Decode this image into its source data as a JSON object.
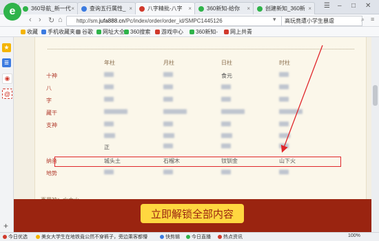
{
  "browser": {
    "tabs": [
      {
        "title": "360导航_新一代",
        "color": "#2fb34a",
        "active": false
      },
      {
        "title": "查询五行属性_",
        "color": "#3c7be0",
        "active": false
      },
      {
        "title": "八字精批-八字",
        "color": "#d0392b",
        "active": true
      },
      {
        "title": "360新知-给你",
        "color": "#2fb34a",
        "active": false
      },
      {
        "title": "创建新知_360新",
        "color": "#2fb34a",
        "active": false
      }
    ],
    "url_prefix": "http://sm.",
    "url_domain": "jufa888.cn",
    "url_rest": "/Pc/index/order/order_id/SMPC1445126",
    "search_value": "高玩竟遭小学生暴虐",
    "bookmarks": [
      {
        "label": "收藏",
        "color": "#f4b400"
      },
      {
        "label": "手机收藏夹",
        "color": "#3c7be0"
      },
      {
        "label": "谷歌",
        "color": "#888888"
      },
      {
        "label": "网址大全",
        "color": "#2fb34a"
      },
      {
        "label": "360搜索",
        "color": "#2fb34a"
      },
      {
        "label": "游戏中心",
        "color": "#d0392b"
      },
      {
        "label": "360新知-",
        "color": "#2fb34a"
      },
      {
        "label": "网上共青",
        "color": "#d0392b"
      }
    ]
  },
  "sidebar": {
    "icons": [
      "star-icon",
      "list-icon",
      "weibo-icon",
      "at-icon"
    ]
  },
  "bazi": {
    "columns": [
      "年柱",
      "月柱",
      "日柱",
      "时柱"
    ],
    "rows": [
      {
        "label": "十神",
        "v": [
          "",
          "",
          "食元",
          ""
        ]
      },
      {
        "label": "八",
        "v": [
          "",
          "",
          "",
          ""
        ]
      },
      {
        "label": "字",
        "v": [
          "",
          "",
          "",
          ""
        ]
      },
      {
        "label": "藏干",
        "v": [
          "",
          "",
          "",
          ""
        ]
      },
      {
        "label": "支神",
        "v": [
          "",
          "",
          "",
          ""
        ]
      },
      {
        "label": "",
        "v": [
          "正",
          "",
          "",
          ""
        ]
      },
      {
        "label": "纳音",
        "v": [
          "城头土",
          "石榴木",
          "钗钏金",
          "山下火"
        ]
      },
      {
        "label": "地势",
        "v": [
          "",
          "",
          "",
          ""
        ]
      }
    ],
    "footer_label": "喜用神：",
    "footer_value": "水木火"
  },
  "unlock": {
    "label": "立即解锁全部内容"
  },
  "status": {
    "items": [
      {
        "label": "今日优选",
        "color": "#d0392b"
      },
      {
        "label": "美女大学生在地铁竟公然不穿裤子，旁边乘客都懵",
        "color": "#f4b400"
      },
      {
        "label": "快剪辑",
        "color": "#3c7be0"
      },
      {
        "label": "今日直播",
        "color": "#2fb34a"
      },
      {
        "label": "热点资讯",
        "color": "#d0392b"
      }
    ],
    "zoom": "100%"
  },
  "colors": {
    "accent_red": "#e0262a",
    "unlock_bg": "#9a2410",
    "unlock_btn": "#ffd740"
  }
}
